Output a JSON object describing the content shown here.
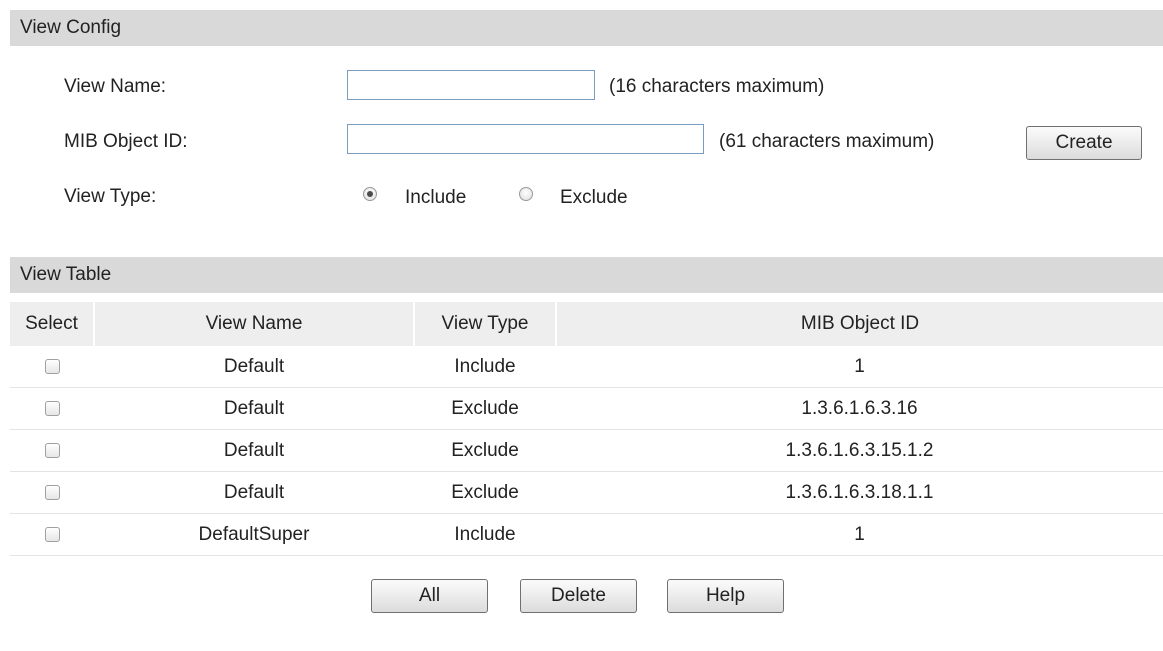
{
  "view_config": {
    "title": "View Config",
    "view_name_label": "View Name:",
    "view_name_value": "",
    "view_name_hint": "(16 characters maximum)",
    "mib_object_id_label": "MIB Object ID:",
    "mib_object_id_value": "",
    "mib_object_id_hint": "(61 characters maximum)",
    "create_label": "Create",
    "view_type_label": "View Type:",
    "view_type_options": [
      "Include",
      "Exclude"
    ],
    "view_type_selected": "Include"
  },
  "view_table": {
    "title": "View Table",
    "columns": [
      "Select",
      "View Name",
      "View Type",
      "MIB Object ID"
    ],
    "rows": [
      {
        "view_name": "Default",
        "view_type": "Include",
        "mib_object_id": "1",
        "selected": false
      },
      {
        "view_name": "Default",
        "view_type": "Exclude",
        "mib_object_id": "1.3.6.1.6.3.16",
        "selected": false
      },
      {
        "view_name": "Default",
        "view_type": "Exclude",
        "mib_object_id": "1.3.6.1.6.3.15.1.2",
        "selected": false
      },
      {
        "view_name": "Default",
        "view_type": "Exclude",
        "mib_object_id": "1.3.6.1.6.3.18.1.1",
        "selected": false
      },
      {
        "view_name": "DefaultSuper",
        "view_type": "Include",
        "mib_object_id": "1",
        "selected": false
      }
    ]
  },
  "actions": {
    "all_label": "All",
    "delete_label": "Delete",
    "help_label": "Help"
  },
  "colors": {
    "section_header_bg": "#d9d9d9",
    "table_header_bg": "#eeeeee",
    "input_border": "#7a9cc0"
  }
}
